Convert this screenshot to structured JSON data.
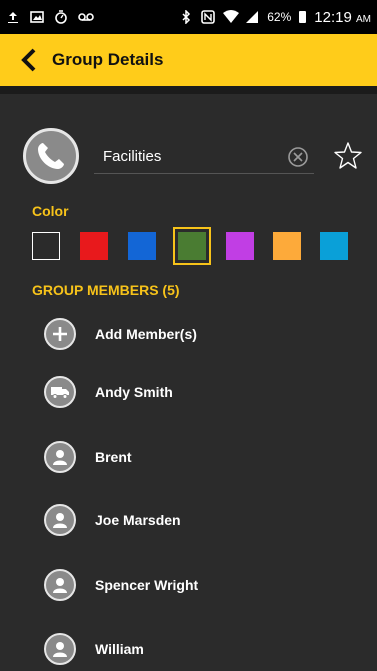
{
  "statusbar": {
    "left_icons": [
      "upload-icon",
      "image-icon",
      "timer-icon",
      "voicemail-icon"
    ],
    "right_icons": [
      "bluetooth-icon",
      "nfc-icon",
      "wifi-icon",
      "signal-icon"
    ],
    "battery": "62%",
    "time": "12:19",
    "ampm": "AM"
  },
  "header": {
    "title": "Group Details"
  },
  "group": {
    "name": "Facilities"
  },
  "color": {
    "label": "Color",
    "swatches": [
      "#ffffff",
      "#e8191c",
      "#1366d6",
      "#4a7c32",
      "#c13ee4",
      "#fdaa3a",
      "#0aa0d8"
    ],
    "selected_index": 3
  },
  "members": {
    "label": "GROUP MEMBERS (5)",
    "add_label": "Add Member(s)",
    "items": [
      {
        "name": "Andy Smith",
        "icon": "truck-icon"
      },
      {
        "name": "Brent",
        "icon": "person-icon"
      },
      {
        "name": "Joe Marsden",
        "icon": "person-icon"
      },
      {
        "name": "Spencer Wright",
        "icon": "person-icon"
      },
      {
        "name": "William",
        "icon": "person-icon"
      }
    ]
  }
}
